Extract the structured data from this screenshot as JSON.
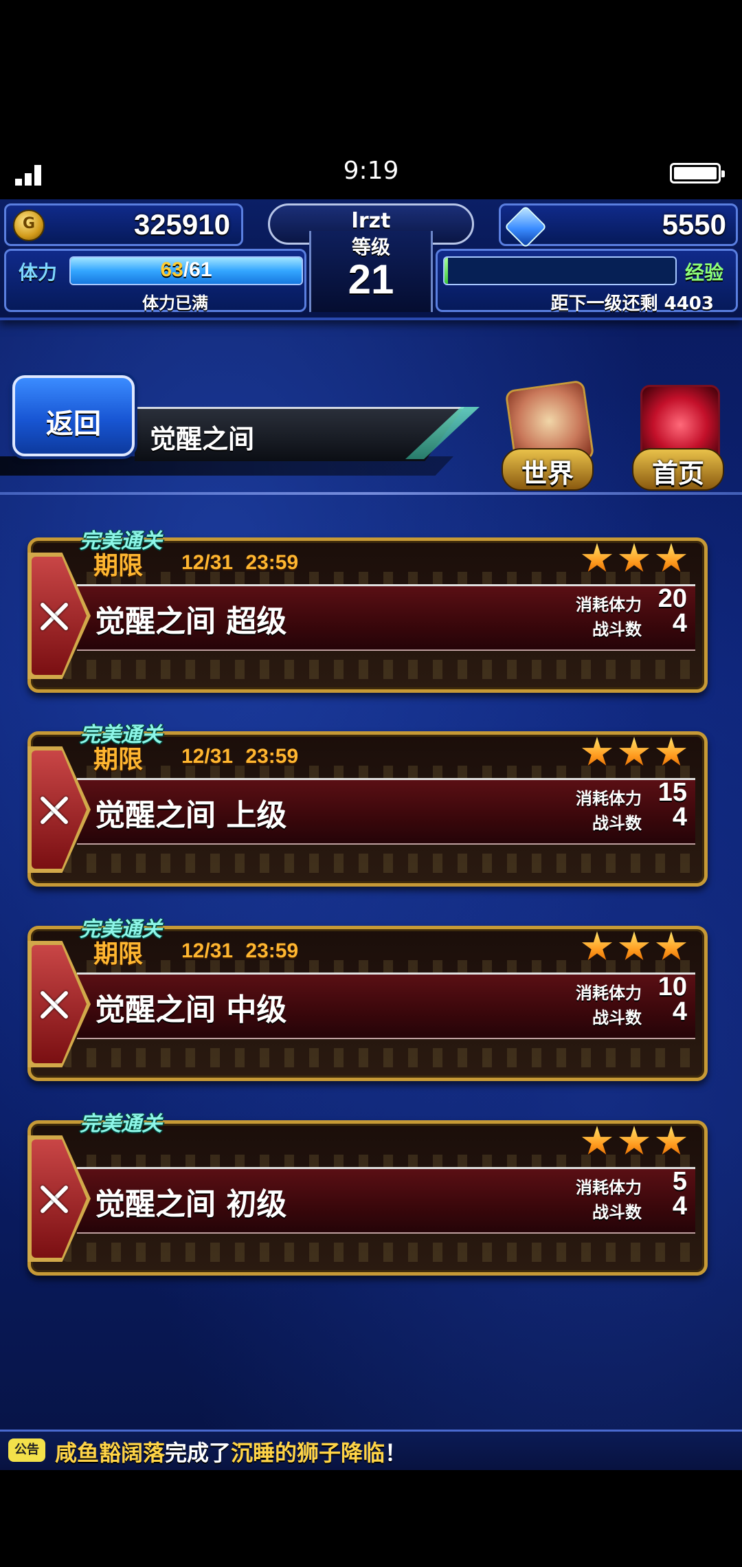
{
  "status_bar": {
    "time": "9:19"
  },
  "hud": {
    "gil": "325910",
    "gems": "5550",
    "player_name": "lrzt",
    "level_label": "等级",
    "level": "21",
    "stamina_label": "体力",
    "stamina_current": "63",
    "stamina_max": "/61",
    "stamina_status": "体力已满",
    "exp_label": "经验",
    "exp_remaining_text": "距下一级还剩 4403",
    "exp_progress": 0.01
  },
  "header": {
    "back_label": "返回",
    "title": "觉醒之间",
    "world_label": "世界",
    "home_label": "首页"
  },
  "quest_labels": {
    "perfect": "完美通关",
    "limit": "期限",
    "cost_label": "消耗体力",
    "battles_label": "战斗数"
  },
  "quests": [
    {
      "name": "觉醒之间 超级",
      "deadline": "12/31 23:59",
      "cost": "20",
      "battles": "4",
      "stars": 3
    },
    {
      "name": "觉醒之间 上级",
      "deadline": "12/31 23:59",
      "cost": "15",
      "battles": "4",
      "stars": 3
    },
    {
      "name": "觉醒之间 中级",
      "deadline": "12/31 23:59",
      "cost": "10",
      "battles": "4",
      "stars": 3
    },
    {
      "name": "觉醒之间 初级",
      "deadline": "",
      "cost": "5",
      "battles": "4",
      "stars": 3
    }
  ],
  "announcement": {
    "badge": "公告",
    "player": "咸鱼豁阔落",
    "middle": "完成了",
    "event": "沉睡的狮子降临",
    "end": "！"
  },
  "colors": {
    "accent_gold": "#ffb630",
    "perfect_cyan": "#8df6e8",
    "band_red": "#5a0f14",
    "background_blue": "#0c2275"
  }
}
